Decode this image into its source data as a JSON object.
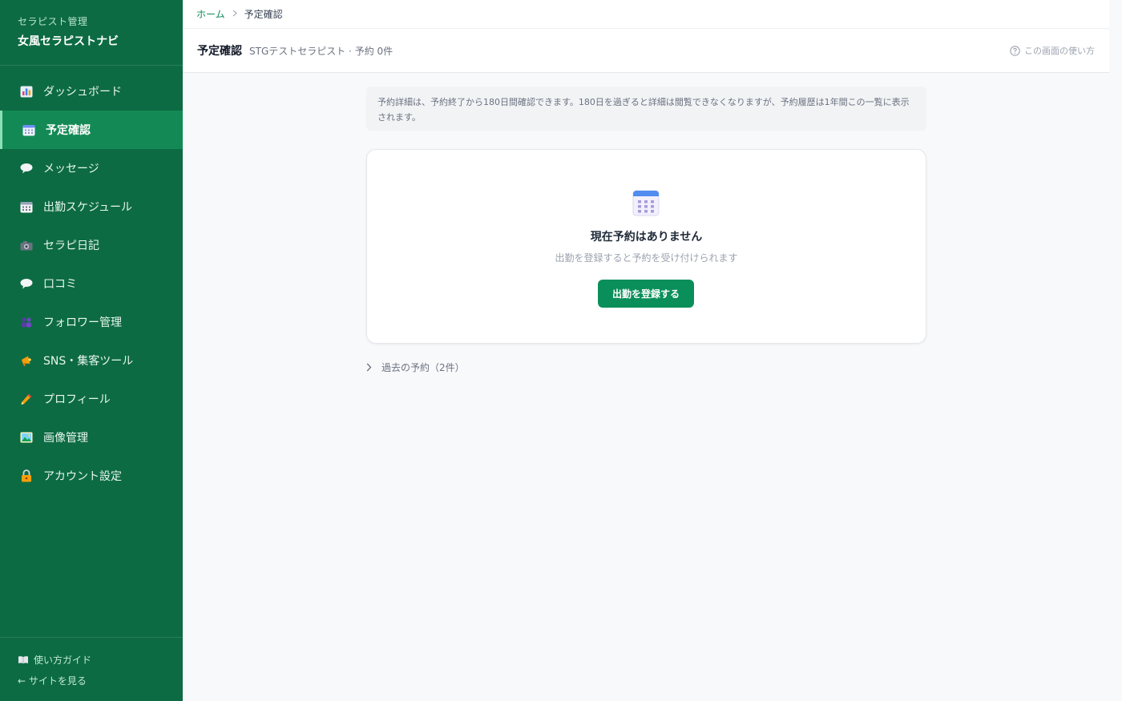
{
  "sidebar": {
    "brand_sub": "セラピスト管理",
    "brand_title": "女風セラピストナビ",
    "items": [
      {
        "label": "ダッシュボード",
        "icon": "bar-chart-icon"
      },
      {
        "label": "予定確認",
        "icon": "calendar-icon",
        "active": true
      },
      {
        "label": "メッセージ",
        "icon": "speech-bubble-icon"
      },
      {
        "label": "出勤スケジュール",
        "icon": "schedule-icon"
      },
      {
        "label": "セラピ日記",
        "icon": "camera-icon"
      },
      {
        "label": "口コミ",
        "icon": "speech-bubble-icon"
      },
      {
        "label": "フォロワー管理",
        "icon": "people-icon"
      },
      {
        "label": "SNS・集客ツール",
        "icon": "megaphone-icon"
      },
      {
        "label": "プロフィール",
        "icon": "pencil-icon"
      },
      {
        "label": "画像管理",
        "icon": "picture-icon"
      },
      {
        "label": "アカウント設定",
        "icon": "lock-icon"
      }
    ],
    "footer": {
      "guide_label": "使い方ガイド",
      "site_label": "← サイトを見る"
    }
  },
  "breadcrumb": {
    "home": "ホーム",
    "current": "予定確認"
  },
  "header": {
    "title": "予定確認",
    "subtitle": "STGテストセラピスト · 予約 0件",
    "help_label": "この画面の使い方"
  },
  "notice": {
    "text": "予約詳細は、予約終了から180日間確認できます。180日を過ぎると詳細は閲覧できなくなりますが、予約履歴は1年間この一覧に表示されます。"
  },
  "empty_state": {
    "title": "現在予約はありません",
    "description": "出勤を登録すると予約を受け付けられます",
    "button_label": "出勤を登録する"
  },
  "past": {
    "label": "過去の予約（2件）"
  },
  "colors": {
    "sidebar_bg": "#0d6b43",
    "active_item_bg": "#138a55",
    "primary": "#0b8f5a",
    "page_bg": "#f8f9fb"
  }
}
